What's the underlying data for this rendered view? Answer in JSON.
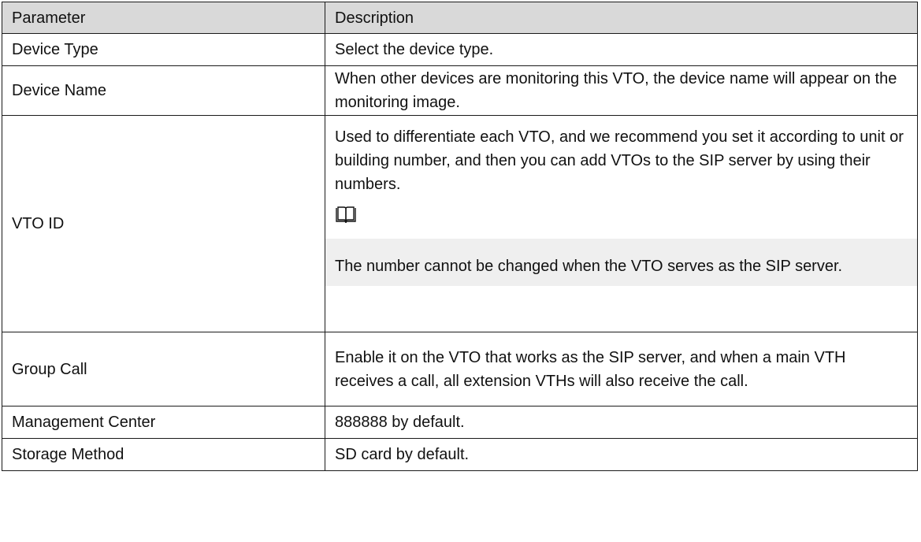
{
  "header": {
    "parameter": "Parameter",
    "description": "Description"
  },
  "rows": [
    {
      "parameter": "Device Type",
      "description": "Select the device type."
    },
    {
      "parameter": "Device Name",
      "description": "When other devices are monitoring this VTO, the device name will appear on the monitoring image."
    },
    {
      "parameter": "VTO ID",
      "description": "Used to differentiate each VTO, and we recommend you set it according to unit or building number, and then you can add VTOs to the SIP server by using their numbers.",
      "note_icon": "book-note-icon",
      "note": "The number cannot be changed when the VTO serves as the SIP server."
    },
    {
      "parameter": "Group Call",
      "description": "Enable it on the VTO that works as the SIP server, and when a main VTH receives a call, all extension VTHs will also receive the call."
    },
    {
      "parameter": "Management Center",
      "description": "888888 by default."
    },
    {
      "parameter": "Storage Method",
      "description": "SD card by default."
    }
  ]
}
